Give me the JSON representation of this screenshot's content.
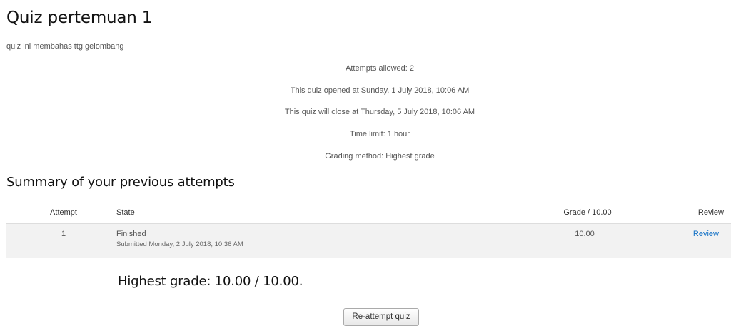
{
  "quiz": {
    "title": "Quiz pertemuan 1",
    "intro": "quiz ini membahas ttg gelombang"
  },
  "info": {
    "attempts_allowed": "Attempts allowed: 2",
    "opened": "This quiz opened at Sunday, 1 July 2018, 10:06 AM",
    "closes": "This quiz will close at Thursday, 5 July 2018, 10:06 AM",
    "time_limit": "Time limit: 1 hour",
    "grading_method": "Grading method: Highest grade"
  },
  "summary": {
    "heading": "Summary of your previous attempts",
    "columns": {
      "attempt": "Attempt",
      "state": "State",
      "grade": "Grade / 10.00",
      "review": "Review"
    },
    "rows": [
      {
        "attempt": "1",
        "state": "Finished",
        "submitted": "Submitted Monday, 2 July 2018, 10:36 AM",
        "grade": "10.00",
        "review": "Review"
      }
    ]
  },
  "result": {
    "highest_grade": "Highest grade: 10.00 / 10.00."
  },
  "actions": {
    "reattempt_label": "Re-attempt quiz"
  },
  "colors": {
    "link": "#0f6fc5",
    "row_background": "#f2f2f2"
  }
}
